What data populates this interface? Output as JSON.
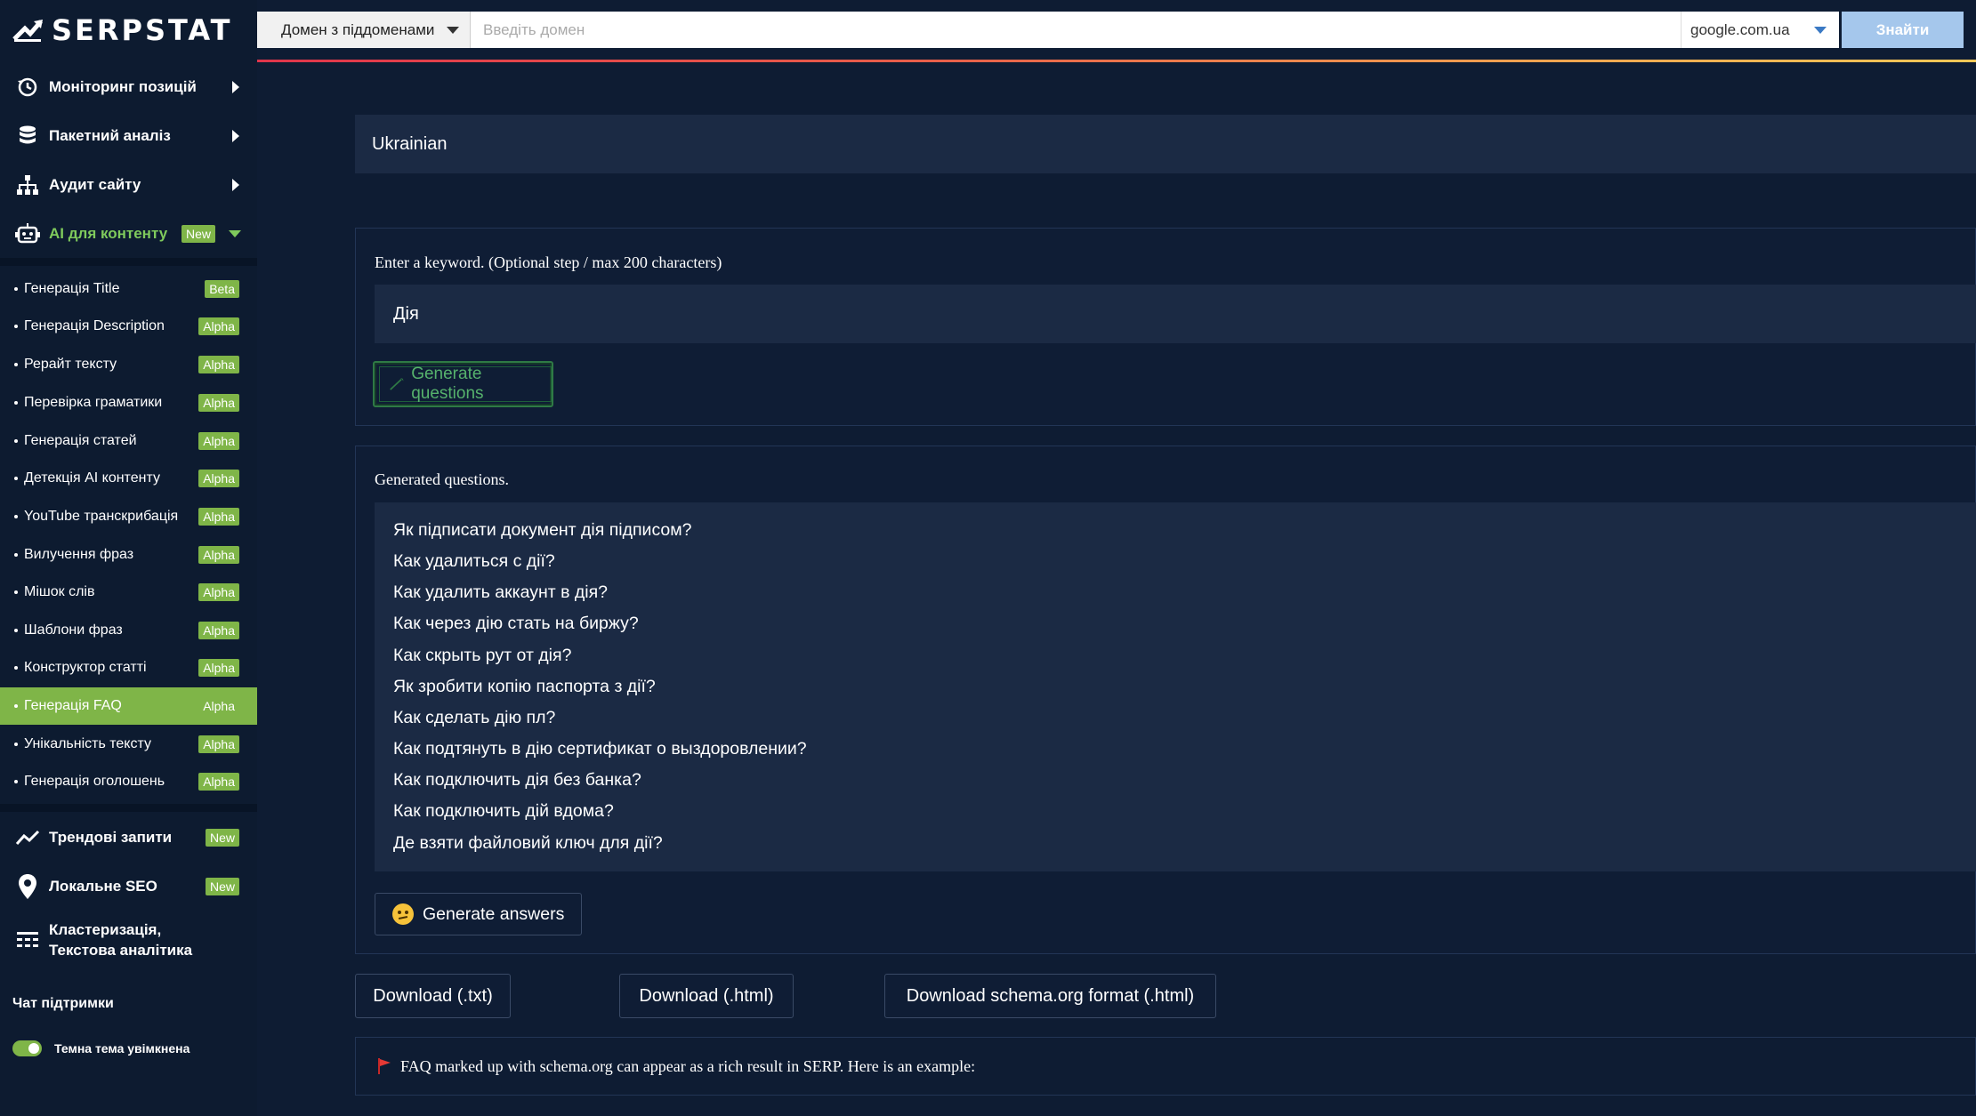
{
  "app": {
    "name": "SERPSTAT"
  },
  "sidebar": {
    "main_items": [
      {
        "label": "Моніторинг позицій",
        "icon": "history-icon"
      },
      {
        "label": "Пакетний аналіз",
        "icon": "database-icon"
      },
      {
        "label": "Аудит сайту",
        "icon": "sitemap-icon"
      },
      {
        "label": "AI для контенту",
        "icon": "robot-icon",
        "badge": "New"
      }
    ],
    "sub_items": [
      {
        "label": "Генерація Title",
        "badge": "Beta"
      },
      {
        "label": "Генерація Description",
        "badge": "Alpha"
      },
      {
        "label": "Рерайт тексту",
        "badge": "Alpha"
      },
      {
        "label": "Перевірка граматики",
        "badge": "Alpha"
      },
      {
        "label": "Генерація статей",
        "badge": "Alpha"
      },
      {
        "label": "Детекція AI контенту",
        "badge": "Alpha"
      },
      {
        "label": "YouTube транскрибація",
        "badge": "Alpha"
      },
      {
        "label": "Вилучення фраз",
        "badge": "Alpha"
      },
      {
        "label": "Мішок слів",
        "badge": "Alpha"
      },
      {
        "label": "Шаблони фраз",
        "badge": "Alpha"
      },
      {
        "label": "Конструктор статті",
        "badge": "Alpha"
      },
      {
        "label": "Генерація FAQ",
        "badge": "Alpha"
      },
      {
        "label": "Унікальність тексту",
        "badge": "Alpha"
      },
      {
        "label": "Генерація оголошень",
        "badge": "Alpha"
      }
    ],
    "bottom_items": [
      {
        "label": "Трендові запити",
        "badge": "New"
      },
      {
        "label": "Локальне SEO",
        "badge": "New"
      },
      {
        "label_line1": "Кластеризація,",
        "label_line2": "Текстова аналітика"
      }
    ],
    "support": "Чат підтримки",
    "theme_toggle": "Темна тема увімкнена"
  },
  "search": {
    "scope": "Домен з піддоменами",
    "placeholder": "Введіть домен",
    "engine": "google.com.ua",
    "find_label": "Знайти"
  },
  "main": {
    "language": "Ukrainian",
    "keyword_prompt": "Enter a keyword. (Optional step / max 200 characters)",
    "keyword_value": "Дія",
    "generate_questions": "Generate questions",
    "generated_label": "Generated questions.",
    "questions": [
      "Як підписати документ дія підписом?",
      "Как удалиться с дії?",
      "Как удалить аккаунт в дія?",
      "Как через дію стать на биржу?",
      "Как скрыть рут от дія?",
      "Як зробити копію паспорта з дії?",
      "Как сделать дію пл?",
      "Как подтянуть в дію сертификат о выздоровлении?",
      "Как подключить дія без банка?",
      "Как подключить дій вдома?",
      "Де взяти файловий ключ для дії?"
    ],
    "generate_answers": "Generate answers",
    "downloads": [
      "Download (.txt)",
      "Download (.html)",
      "Download schema.org format (.html)"
    ],
    "info": "FAQ marked up with schema.org can appear as a rich result in SERP. Here is an example:"
  },
  "colors": {
    "background": "#0e1c33",
    "accent_green": "#7fb548",
    "field_bg": "#1b2a44",
    "find_button": "#a5c7ec"
  }
}
